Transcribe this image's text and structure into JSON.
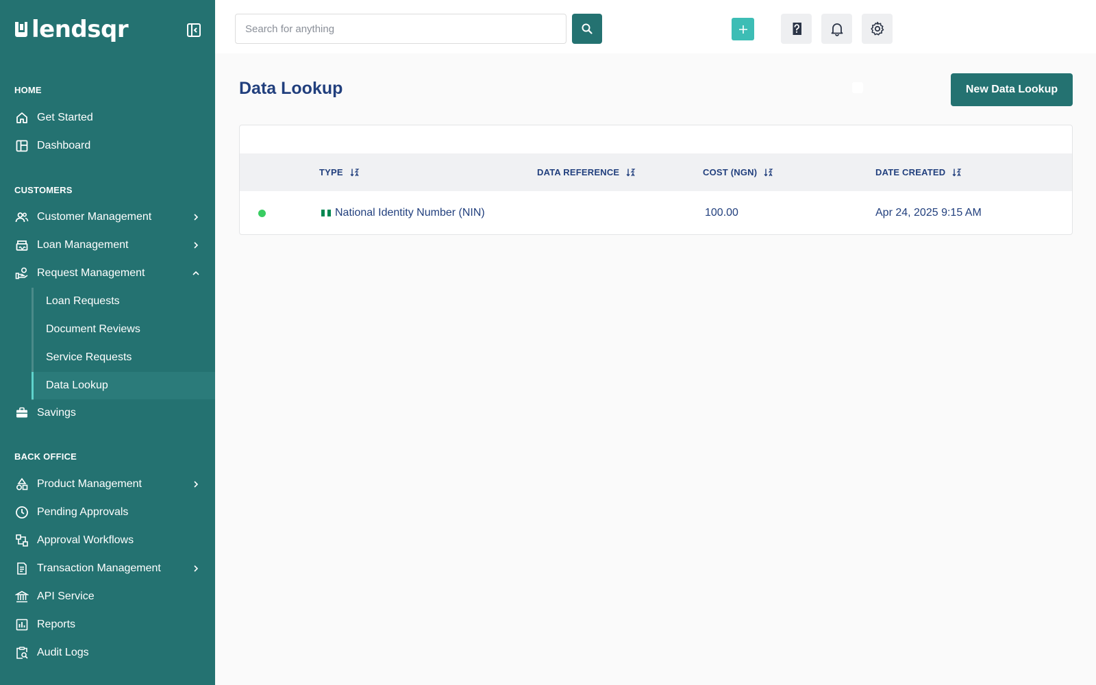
{
  "brand": {
    "name": "lendsqr"
  },
  "sidebar": {
    "sections": {
      "home": "HOME",
      "customers": "CUSTOMERS",
      "back_office": "BACK OFFICE"
    },
    "home_items": [
      {
        "label": "Get Started",
        "icon": "home-icon"
      },
      {
        "label": "Dashboard",
        "icon": "dashboard-icon"
      }
    ],
    "customer_items": [
      {
        "label": "Customer Management",
        "icon": "users-icon"
      },
      {
        "label": "Loan Management",
        "icon": "bank-icon"
      },
      {
        "label": "Request Management",
        "icon": "hand-money-icon"
      }
    ],
    "request_subitems": [
      {
        "label": "Loan Requests"
      },
      {
        "label": "Document Reviews"
      },
      {
        "label": "Service Requests"
      },
      {
        "label": "Data Lookup",
        "active": true
      }
    ],
    "savings": {
      "label": "Savings",
      "icon": "briefcase-icon"
    },
    "back_office_items": [
      {
        "label": "Product Management",
        "icon": "shapes-icon"
      },
      {
        "label": "Pending Approvals",
        "icon": "clock-icon"
      },
      {
        "label": "Approval Workflows",
        "icon": "workflow-icon"
      },
      {
        "label": "Transaction Management",
        "icon": "receipt-icon"
      },
      {
        "label": "API Service",
        "icon": "institution-icon"
      },
      {
        "label": "Reports",
        "icon": "chart-icon"
      },
      {
        "label": "Audit Logs",
        "icon": "clipboard-search-icon"
      }
    ]
  },
  "topbar": {
    "search": {
      "placeholder": "Search for anything"
    }
  },
  "main": {
    "title": "Data Lookup",
    "new_button": "New Data Lookup",
    "table": {
      "columns": [
        "TYPE",
        "DATA REFERENCE",
        "COST (NGN)",
        "DATE CREATED"
      ],
      "rows": [
        {
          "status": "active",
          "type": "National Identity Number (NIN)",
          "data_reference": "",
          "cost": "100.00",
          "date_created": "Apr 24, 2025 9:15 AM"
        }
      ]
    }
  },
  "colors": {
    "sidebar_bg": "#247271",
    "accent": "#3dbdb5",
    "title": "#213f7d",
    "status_green": "#39cd62"
  }
}
